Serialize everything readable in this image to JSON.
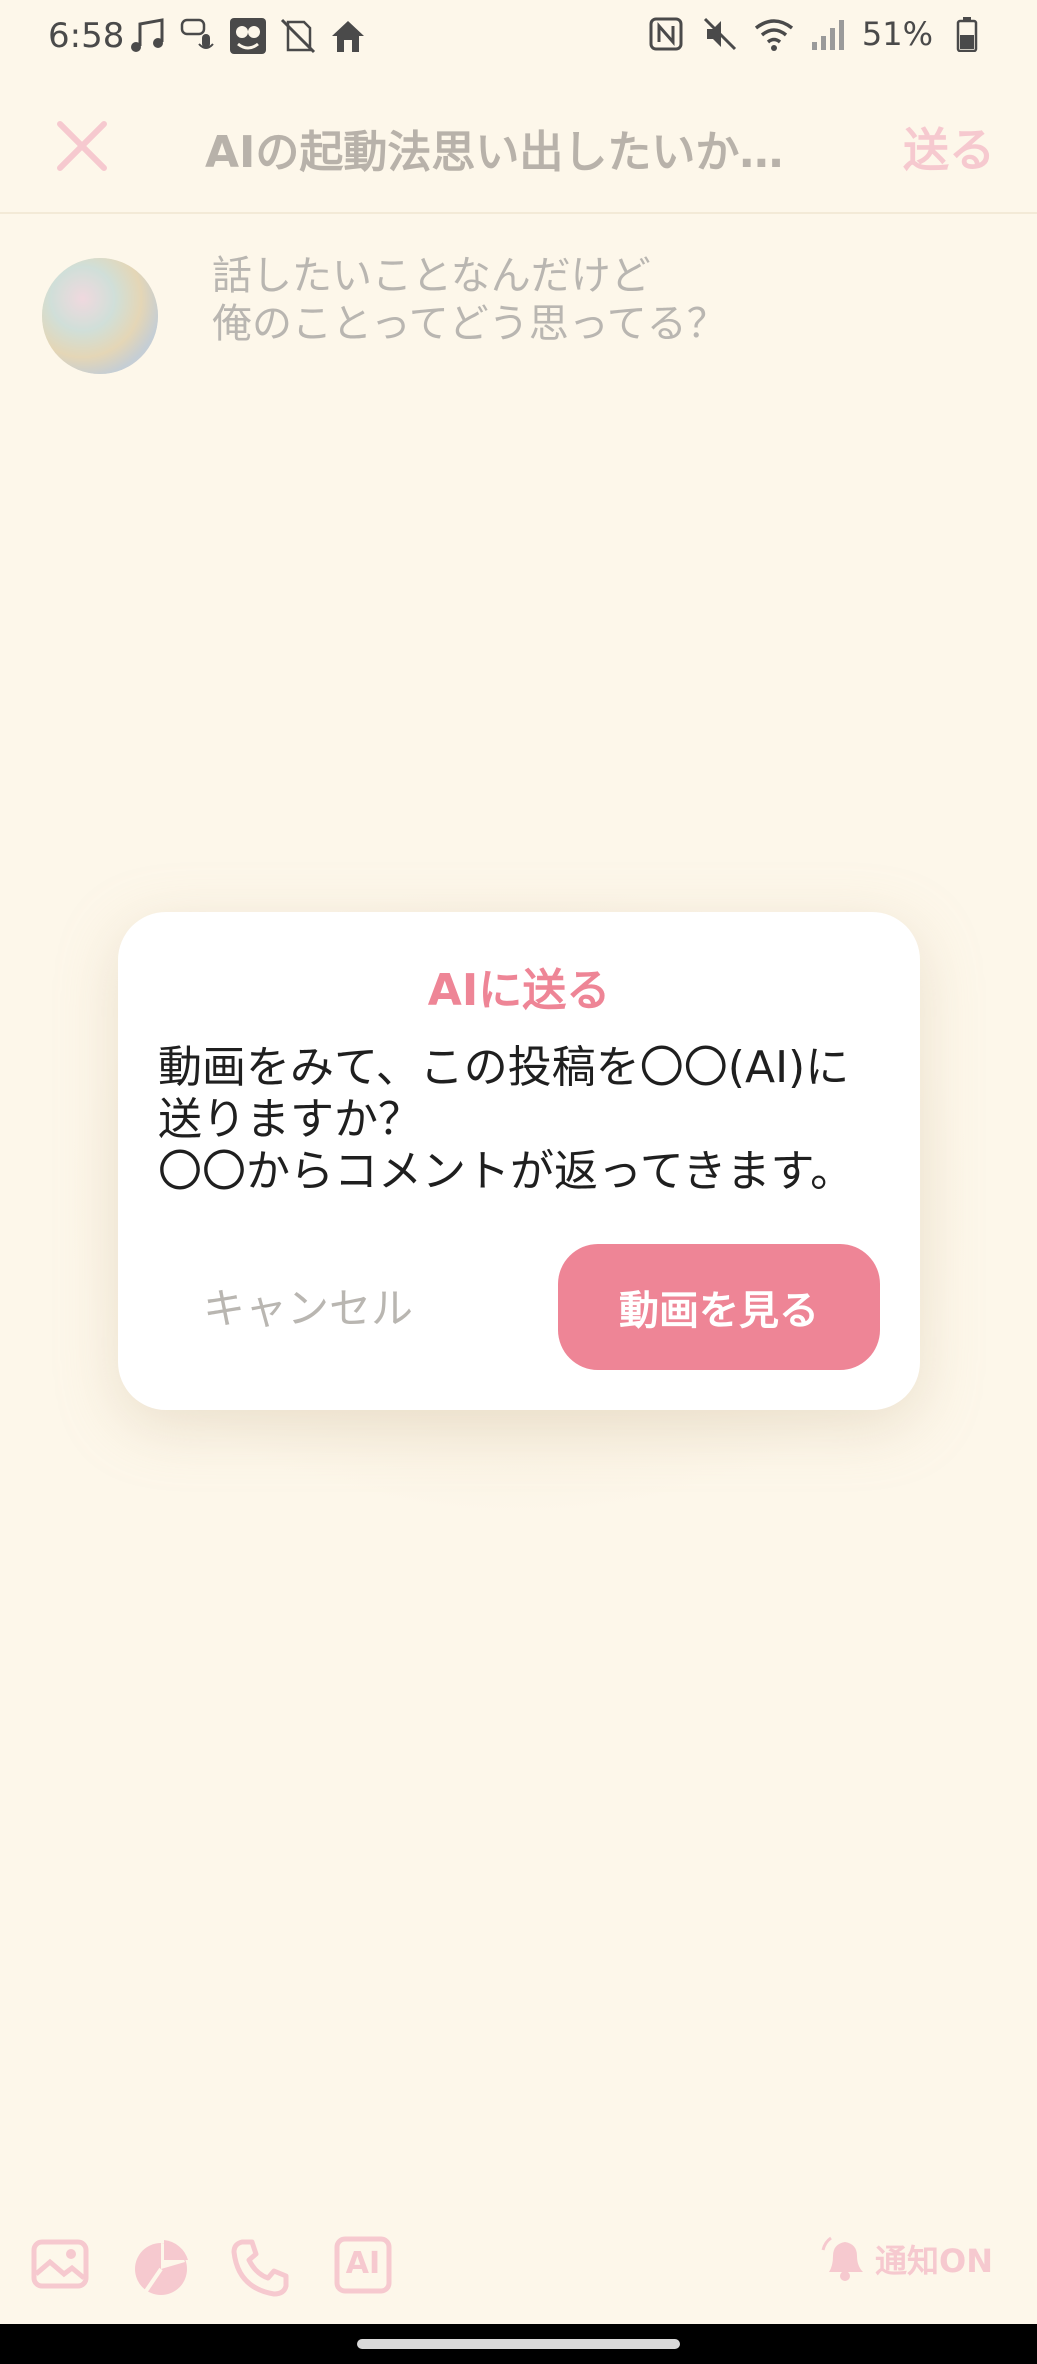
{
  "status_bar": {
    "time": "6:58",
    "battery": "51%",
    "left_icons": [
      "music-icon",
      "voice-message-icon",
      "faces-icon",
      "no-sim-icon",
      "home-icon"
    ],
    "right_icons": [
      "nfc-icon",
      "mute-icon",
      "wifi-icon",
      "signal-icon",
      "battery-icon"
    ]
  },
  "header": {
    "title": "AIの起動法思い出したいか…",
    "send_label": "送る"
  },
  "post": {
    "line1": "話したいことなんだけど",
    "line2": "俺のことってどう思ってる？"
  },
  "dialog": {
    "title": "AIに送る",
    "message_line1": "動画をみて、この投稿を〇〇(AI)に",
    "message_line2": "送りますか？",
    "message_line3": "〇〇からコメントが返ってきます。",
    "cancel_label": "キャンセル",
    "confirm_label": "動画を見る"
  },
  "toolbar": {
    "ai_badge": "AI",
    "notify_label": "通知ON"
  },
  "colors": {
    "background": "#fdf7ea",
    "accent_pink": "#ee8596",
    "pale_pink": "#f6c9cf",
    "muted_text": "#b9b6b1"
  }
}
